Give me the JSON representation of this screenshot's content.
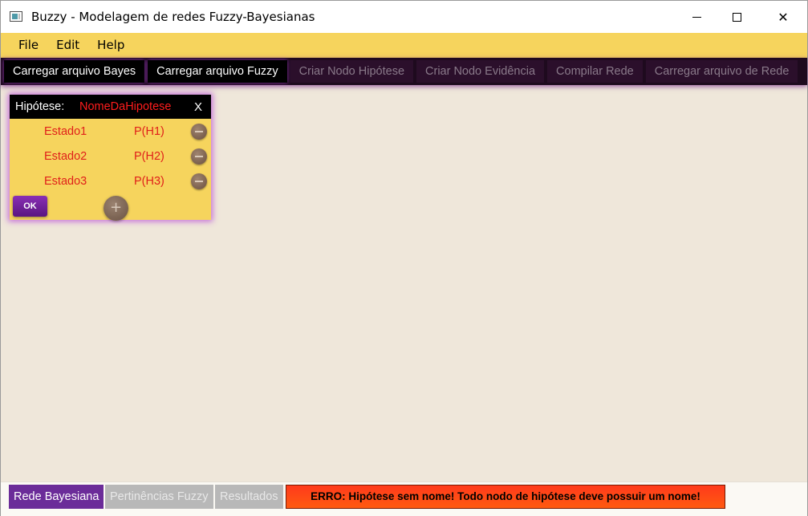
{
  "window": {
    "title": "Buzzy - Modelagem de redes Fuzzy-Bayesianas",
    "controls": {
      "minimize": "minimize-icon",
      "maximize": "maximize-icon",
      "close": "✕"
    }
  },
  "menu": {
    "items": [
      {
        "label": "File"
      },
      {
        "label": "Edit"
      },
      {
        "label": "Help"
      }
    ]
  },
  "toolbar": {
    "buttons": [
      {
        "label": "Carregar arquivo Bayes",
        "enabled": true
      },
      {
        "label": "Carregar arquivo Fuzzy",
        "enabled": true
      },
      {
        "label": "Criar Nodo Hipótese",
        "enabled": false
      },
      {
        "label": "Criar Nodo Evidência",
        "enabled": false
      },
      {
        "label": "Compilar Rede",
        "enabled": false
      },
      {
        "label": "Carregar arquivo de Rede",
        "enabled": false
      }
    ]
  },
  "hypothesis_panel": {
    "label": "Hipótese:",
    "name": "NomeDaHipotese",
    "close_label": "X",
    "states": [
      {
        "name": "Estado1",
        "probability": "P(H1)"
      },
      {
        "name": "Estado2",
        "probability": "P(H2)"
      },
      {
        "name": "Estado3",
        "probability": "P(H3)"
      }
    ],
    "ok_label": "OK",
    "add_label": "+"
  },
  "status_bar": {
    "tabs": [
      {
        "label": "Rede Bayesiana",
        "active": true
      },
      {
        "label": "Pertinências Fuzzy",
        "active": false
      },
      {
        "label": "Resultados",
        "active": false
      }
    ],
    "error": "ERRO: Hipótese sem nome! Todo nodo de hipótese deve possuir um nome!"
  },
  "colors": {
    "menu_bg": "#f6d45d",
    "toolbar_bg": "#1e0a1e",
    "canvas_bg": "#efe7da",
    "accent_purple": "#6b2c99",
    "error_red": "#ff3a1c",
    "state_text": "#e0201a"
  }
}
